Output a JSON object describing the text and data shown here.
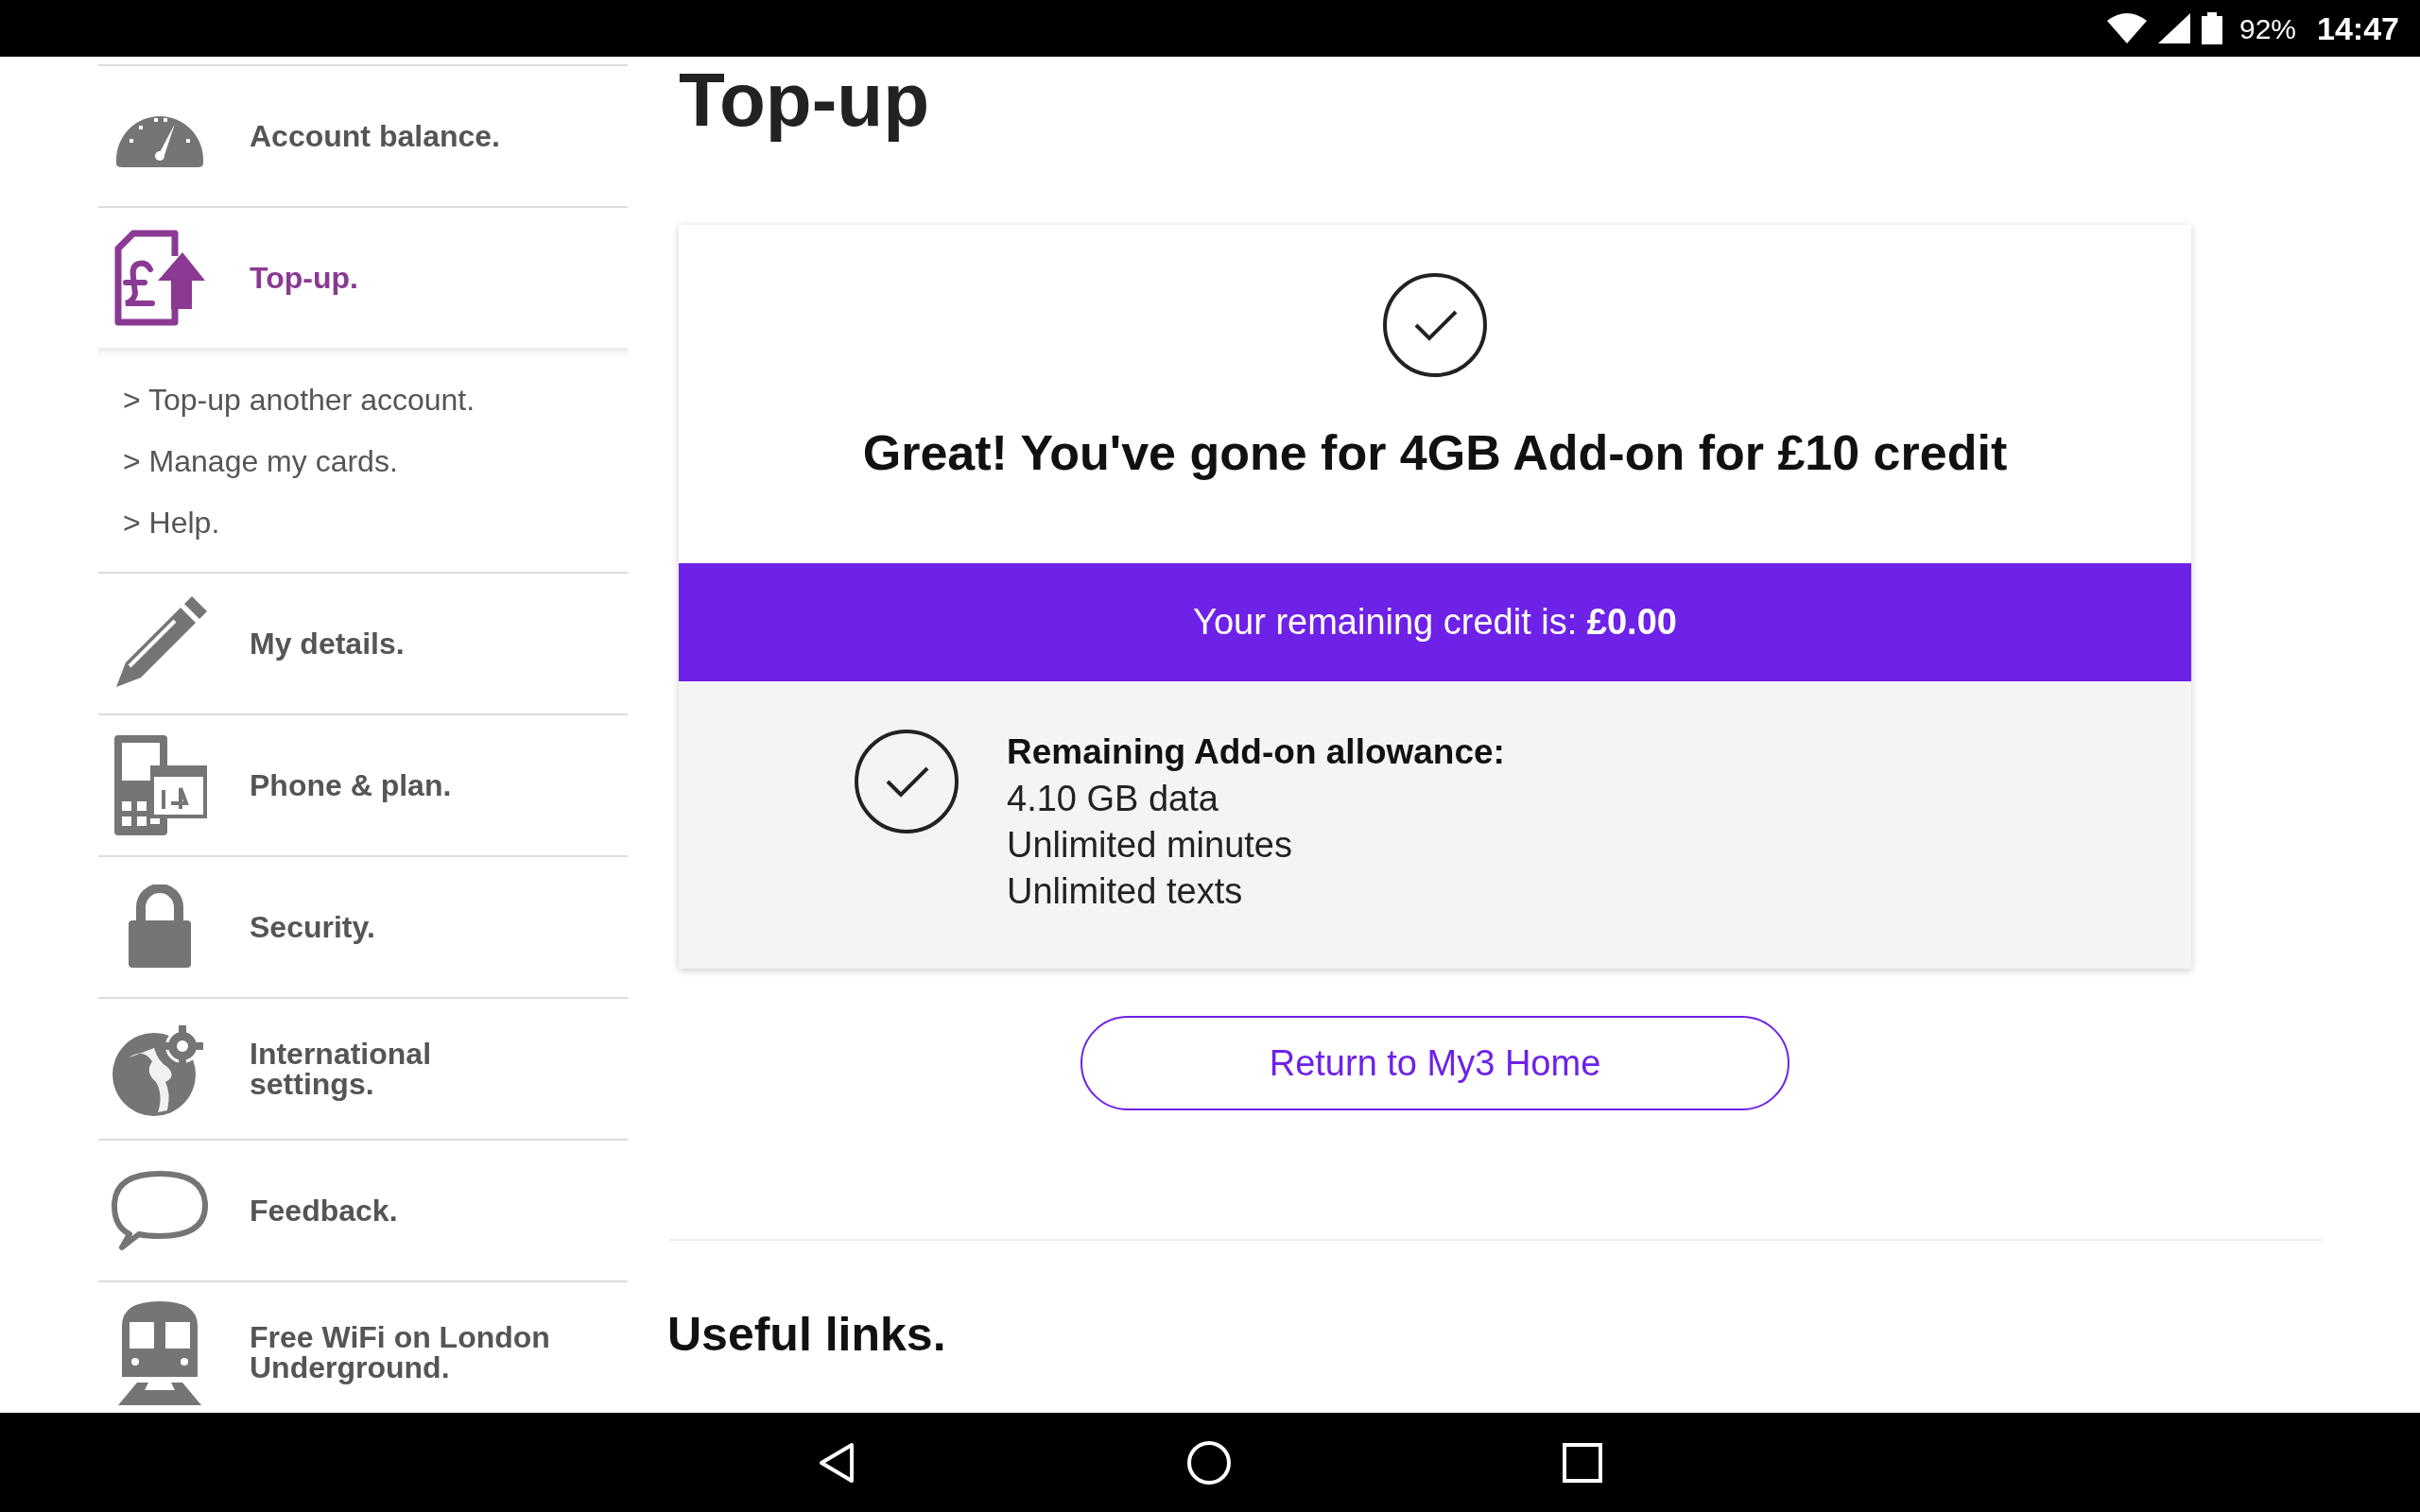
{
  "status_bar": {
    "battery": "92%",
    "time": "14:47"
  },
  "sidebar": {
    "items": [
      {
        "label": "Account balance.",
        "selected": false
      },
      {
        "label": "Top-up.",
        "selected": true,
        "children": [
          {
            "label": "> Top-up another account."
          },
          {
            "label": "> Manage my cards."
          },
          {
            "label": "> Help."
          }
        ]
      },
      {
        "label": "My details.",
        "selected": false
      },
      {
        "label": "Phone & plan.",
        "selected": false
      },
      {
        "label": "Security.",
        "selected": false
      },
      {
        "label": "International settings.",
        "selected": false
      },
      {
        "label": "Feedback.",
        "selected": false
      },
      {
        "label": "Free WiFi on London Underground.",
        "selected": false
      }
    ]
  },
  "page_title": "Top-up",
  "confirmation": {
    "headline": "Great! You've gone for 4GB Add-on for £10 credit",
    "credit": "Your remaining credit is: **£0.00**",
    "allowance_title": "Remaining Add-on allowance:",
    "allowance_lines": [
      "4.10 GB data",
      "Unlimited minutes",
      "Unlimited texts"
    ]
  },
  "return_button": "Return to My3 Home",
  "useful_links_title": "Useful links."
}
